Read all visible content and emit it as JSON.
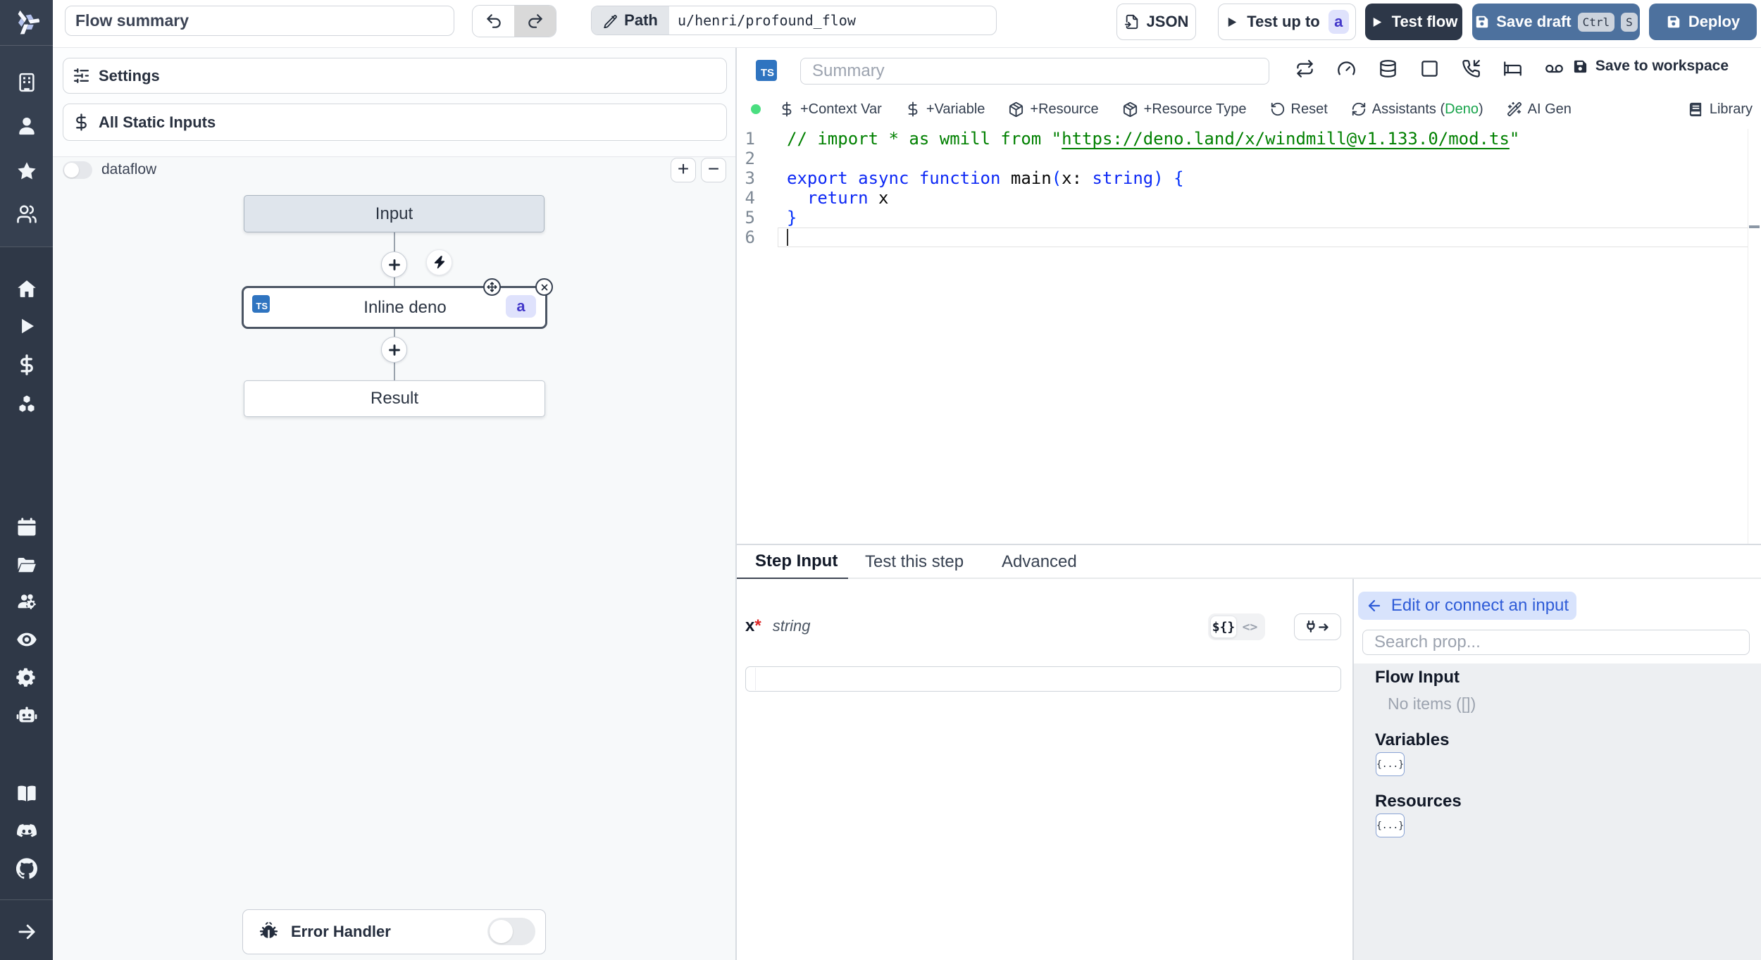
{
  "topbar": {
    "flow_summary_value": "Flow summary",
    "path_label": "Path",
    "path_value": "u/henri/profound_flow",
    "json_button": "JSON",
    "test_up_to_label": "Test up to",
    "test_up_to_badge": "a",
    "test_flow_label": "Test flow",
    "save_draft_label": "Save draft",
    "kbd_ctrl": "Ctrl",
    "kbd_s": "S",
    "deploy_label": "Deploy",
    "icons": [
      "undo-icon",
      "redo-icon",
      "pencil-icon",
      "file-export-icon",
      "play-icon",
      "save-icon"
    ]
  },
  "sidebar": {
    "items": [
      {
        "icon": "building-icon"
      },
      {
        "icon": "user-icon"
      },
      {
        "icon": "star-icon"
      },
      {
        "icon": "users-icon"
      },
      {
        "icon": "home-icon"
      },
      {
        "icon": "play-icon"
      },
      {
        "icon": "dollar-icon"
      },
      {
        "icon": "cubes-icon"
      },
      {
        "icon": "calendar-icon"
      },
      {
        "icon": "folder-open-icon"
      },
      {
        "icon": "users-gear-icon"
      },
      {
        "icon": "eye-icon"
      },
      {
        "icon": "gear-icon"
      },
      {
        "icon": "robot-icon"
      },
      {
        "icon": "book-icon"
      },
      {
        "icon": "discord-icon"
      },
      {
        "icon": "github-icon"
      },
      {
        "icon": "arrow-right-icon"
      }
    ]
  },
  "flow_panel": {
    "settings_label": "Settings",
    "all_static_inputs_label": "All Static Inputs",
    "dataflow_label": "dataflow",
    "zoom_in": "+",
    "zoom_out": "−",
    "graph": {
      "input_label": "Input",
      "step_lang_badge": "TS",
      "step_label": "Inline deno",
      "step_id_badge": "a",
      "result_label": "Result"
    },
    "error_handler_label": "Error Handler"
  },
  "editor": {
    "lang_badge": "TS",
    "summary_placeholder": "Summary",
    "header_icons": [
      "repeat-icon",
      "gauge-icon",
      "database-icon",
      "square-icon",
      "phone-incoming-icon",
      "bed-icon",
      "voicemail-icon"
    ],
    "save_to_workspace_label": "Save to workspace",
    "status_dot_color": "#4ade80",
    "toolbar": {
      "context_var": "+Context Var",
      "variable": "+Variable",
      "resource": "+Resource",
      "resource_type": "+Resource Type",
      "reset": "Reset",
      "assistants_prefix": "Assistants (",
      "assistants_lang": "Deno",
      "assistants_suffix": ")",
      "assistants_lang_color": "#16a34a",
      "ai_gen": "AI Gen",
      "library": "Library"
    },
    "code": {
      "language": "typescript",
      "lines": [
        {
          "n": "1",
          "tokens": [
            {
              "c": "cmt",
              "t": "// import * as wmill from \""
            },
            {
              "c": "lnk",
              "t": "https://deno.land/x/windmill@v1.133.0/mod.ts"
            },
            {
              "c": "cmt",
              "t": "\""
            }
          ]
        },
        {
          "n": "2",
          "tokens": []
        },
        {
          "n": "3",
          "tokens": [
            {
              "c": "kw",
              "t": "export"
            },
            {
              "c": "pl",
              "t": " "
            },
            {
              "c": "kw",
              "t": "async"
            },
            {
              "c": "pl",
              "t": " "
            },
            {
              "c": "kw",
              "t": "function"
            },
            {
              "c": "pl",
              "t": " main"
            },
            {
              "c": "br",
              "t": "("
            },
            {
              "c": "pl",
              "t": "x: "
            },
            {
              "c": "kw",
              "t": "string"
            },
            {
              "c": "br",
              "t": ")"
            },
            {
              "c": "pl",
              "t": " "
            },
            {
              "c": "br",
              "t": "{"
            }
          ]
        },
        {
          "n": "4",
          "tokens": [
            {
              "c": "pl",
              "t": "  "
            },
            {
              "c": "kw",
              "t": "return"
            },
            {
              "c": "pl",
              "t": " x"
            }
          ]
        },
        {
          "n": "5",
          "tokens": [
            {
              "c": "br",
              "t": "}"
            }
          ]
        },
        {
          "n": "6",
          "tokens": []
        }
      ]
    }
  },
  "bottom": {
    "tabs": [
      {
        "label": "Step Input",
        "active": true
      },
      {
        "label": "Test this step",
        "active": false
      },
      {
        "label": "Advanced",
        "active": false
      }
    ],
    "field": {
      "name": "x",
      "required_mark": "*",
      "type": "string",
      "value": ""
    },
    "editor_toggle": {
      "template_label": "${}",
      "code_label": "<>"
    },
    "helper": {
      "edit_or_connect_label": "Edit or connect an input",
      "search_placeholder": "Search prop...",
      "flow_input_label": "Flow Input",
      "flow_input_empty": "No items ([])",
      "variables_label": "Variables",
      "variables_chip": "{...}",
      "resources_label": "Resources",
      "resources_chip": "{...}"
    }
  }
}
